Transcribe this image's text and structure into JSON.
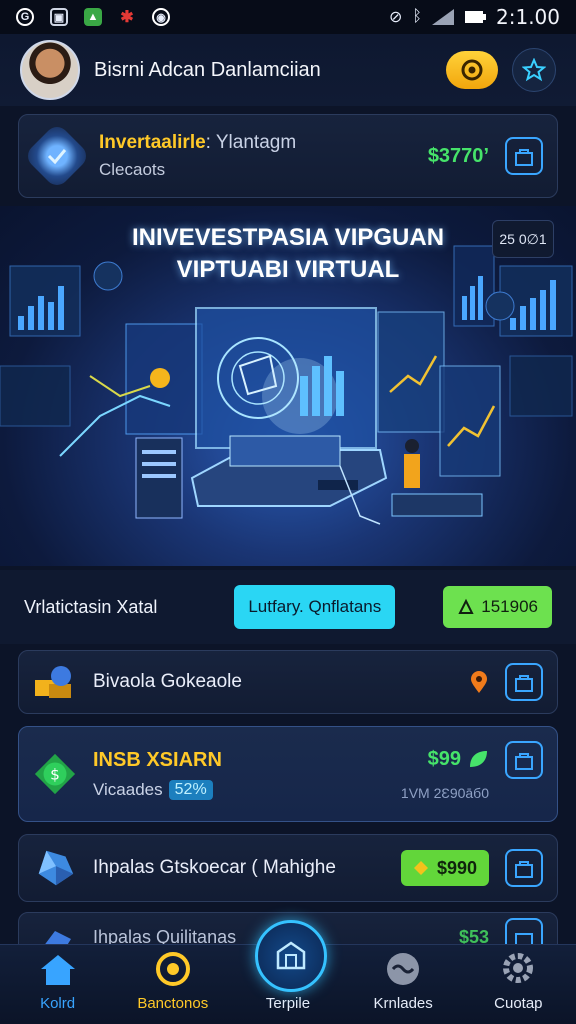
{
  "status_bar": {
    "time": "2:1.00",
    "icons": [
      "browser-icon",
      "gallery-icon",
      "photo-icon",
      "app-icon",
      "camera-icon",
      "mute-icon",
      "bluetooth-icon",
      "signal-icon",
      "battery-icon"
    ]
  },
  "header": {
    "user_name": "Bisrni Adcan Danlamciian",
    "avatar": "user-avatar",
    "buttons": [
      "coin-icon",
      "star-icon"
    ]
  },
  "investment_card": {
    "title_highlight": "Invertaalirle",
    "title_rest": ": Ylantagm",
    "subtitle": "Clecaots",
    "amount": "$3770",
    "amount_suffix": "’"
  },
  "banner": {
    "title_line1": "INIVEVESTPASIA VIPGUAN",
    "title_line2": "VIPTUABI VIRTUAL",
    "badge": "25 0∅1",
    "illustration": "virtual-investment-platform"
  },
  "summary": {
    "label": "Vrlatictasin Xatal",
    "cyan_button": "Lutfary. Qnflatans",
    "green_button": "151906"
  },
  "items": [
    {
      "title": "Bivaola  Gokeaole",
      "icon": "gold-bars-icon"
    },
    {
      "title": "INSB XSIARN",
      "subtitle": "Vicaades",
      "percent": "52%",
      "amount": "$99",
      "note": "1VM 2Ɛ90āб0",
      "icon": "dollar-coin-icon"
    },
    {
      "title": "Ihpalas Gtskoecar ( Mahighe",
      "amount": "$990",
      "icon": "diamond-icon"
    },
    {
      "title": "Ihpalas Quilitanas",
      "amount": "$53",
      "icon": "gem-icon"
    }
  ],
  "nav": [
    {
      "label": "Kolrd",
      "icon": "home-icon"
    },
    {
      "label": "Banctonos",
      "icon": "exchange-icon"
    },
    {
      "label": "Terpile",
      "icon": "portfolio-icon"
    },
    {
      "label": "Krnlades",
      "icon": "chat-icon"
    },
    {
      "label": "Cuotap",
      "icon": "settings-gear-icon"
    }
  ],
  "colors": {
    "background": "#0c1428",
    "accent_blue": "#38a4ff",
    "gold": "#ffc928",
    "green": "#46e36a",
    "cyan": "#2ad6f4"
  }
}
